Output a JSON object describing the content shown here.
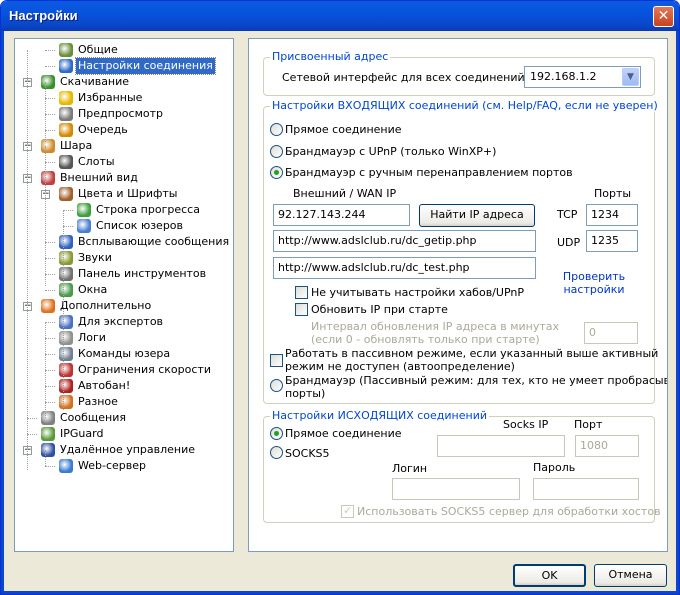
{
  "window": {
    "title": "Настройки",
    "close_label": "✕"
  },
  "tree": {
    "items": [
      {
        "label": "Общие",
        "icon": "users-icon"
      },
      {
        "label": "Настройки соединения",
        "icon": "connection-icon"
      },
      {
        "label": "Скачивание",
        "icon": "download-icon"
      },
      {
        "label": "Избранные",
        "icon": "star-icon"
      },
      {
        "label": "Предпросмотр",
        "icon": "preview-icon"
      },
      {
        "label": "Очередь",
        "icon": "queue-icon"
      },
      {
        "label": "Шара",
        "icon": "share-icon"
      },
      {
        "label": "Слоты",
        "icon": "slots-icon"
      },
      {
        "label": "Внешний вид",
        "icon": "appearance-icon"
      },
      {
        "label": "Цвета и Шрифты",
        "icon": "colors-icon"
      },
      {
        "label": "Строка прогресса",
        "icon": "progress-icon"
      },
      {
        "label": "Список юзеров",
        "icon": "userlist-icon"
      },
      {
        "label": "Всплывающие сообщения",
        "icon": "popup-icon"
      },
      {
        "label": "Звуки",
        "icon": "sound-icon"
      },
      {
        "label": "Панель инструментов",
        "icon": "toolbar-icon"
      },
      {
        "label": "Окна",
        "icon": "windows-icon"
      },
      {
        "label": "Дополнительно",
        "icon": "advanced-icon"
      },
      {
        "label": "Для экспертов",
        "icon": "expert-icon"
      },
      {
        "label": "Логи",
        "icon": "logs-icon"
      },
      {
        "label": "Команды юзера",
        "icon": "commands-icon"
      },
      {
        "label": "Ограничения скорости",
        "icon": "speed-limit-icon"
      },
      {
        "label": "Автобан!",
        "icon": "autoban-icon"
      },
      {
        "label": "Разное",
        "icon": "misc-icon"
      },
      {
        "label": "Сообщения",
        "icon": "messages-icon"
      },
      {
        "label": "IPGuard",
        "icon": "ipguard-icon"
      },
      {
        "label": "Удалённое управление",
        "icon": "remote-icon"
      },
      {
        "label": "Web-сервер",
        "icon": "web-server-icon"
      }
    ]
  },
  "assigned": {
    "caption": "Присвоенный адрес",
    "iface_label": "Сетевой интерфейс для всех соединений",
    "iface_value": "192.168.1.2"
  },
  "incoming": {
    "caption": "Настройки ВХОДЯЩИХ соединений (см. Help/FAQ, если не уверен)",
    "radio_direct": "Прямое соединение",
    "radio_upnp": "Брандмауэр с UPnP (только WinXP+)",
    "radio_manual": "Брандмауэр с ручным перенаправлением портов",
    "wan_label": "Внешний / WAN IP",
    "ports_label": "Порты",
    "wan_ip": "92.127.143.244",
    "find_ip_button": "Найти IP адреса",
    "tcp_label": "TCP",
    "tcp_port": "1234",
    "udp_label": "UDP",
    "udp_port": "1235",
    "getip_url": "http://www.adslclub.ru/dc_getip.php",
    "test_url": "http://www.adslclub.ru/dc_test.php",
    "check_link": "Проверить\nнастройки",
    "ignore_upnp": "Не учитывать настройки хабов/UPnP",
    "update_ip": "Обновить IP при старте",
    "interval_label": "Интервал обновления IP адреса в минутах\n(если 0 - обновлять только при старте)",
    "interval_value": "0",
    "passive_check": "Работать в пассивном режиме, если указанный выше активный\nрежим не доступен (автоопределение)",
    "radio_passive": "Брандмауэр (Пассивный режим: для тех, кто не умеет пробрасывать\nпорты)"
  },
  "outgoing": {
    "caption": "Настройки ИСХОДЯЩИХ соединений",
    "radio_direct": "Прямое соединение",
    "radio_socks": "SOCKS5",
    "socks_ip_label": "Socks IP",
    "port_label": "Порт",
    "port_value": "1080",
    "login_label": "Логин",
    "password_label": "Пароль",
    "use_socks_hosts": "Использовать SOCKS5 сервер для обработки хостов"
  },
  "footer": {
    "ok": "OK",
    "cancel": "Отмена"
  }
}
